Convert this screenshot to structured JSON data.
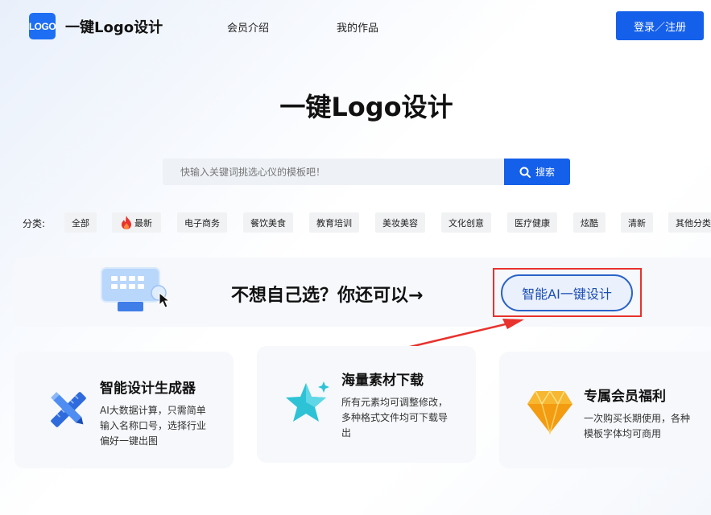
{
  "header": {
    "logo_mark": "LOGO",
    "brand": "一键Logo设计",
    "nav": [
      "会员介绍",
      "我的作品"
    ],
    "login_label": "登录／注册"
  },
  "hero": {
    "title": "一键Logo设计"
  },
  "search": {
    "placeholder": "快输入关键词挑选心仪的模板吧！",
    "button_label": "搜索",
    "icon": "search-icon"
  },
  "categories": {
    "label": "分类:",
    "items": [
      "全部",
      "最新",
      "电子商务",
      "餐饮美食",
      "教育培训",
      "美妆美容",
      "文化创意",
      "医疗健康",
      "炫酷",
      "清新",
      "其他分类"
    ]
  },
  "banner": {
    "text": "不想自己选？你还可以→",
    "ai_button_label": "智能AI一键设计"
  },
  "features": [
    {
      "title": "智能设计生成器",
      "desc_lines": [
        "AI大数据计算，只需简单",
        "输入名称口号，选择行业",
        "偏好一键出图"
      ],
      "icon": "ruler-pencil-icon"
    },
    {
      "title": "海量素材下载",
      "desc_lines": [
        "所有元素均可调整修改，",
        "多种格式文件均可下载导",
        "出"
      ],
      "icon": "star-icon"
    },
    {
      "title": "专属会员福利",
      "desc_lines": [
        "一次购买长期使用，各种",
        "模板字体均可商用"
      ],
      "icon": "diamond-icon"
    }
  ],
  "colors": {
    "primary": "#1560ea",
    "highlight": "#e8322d"
  }
}
